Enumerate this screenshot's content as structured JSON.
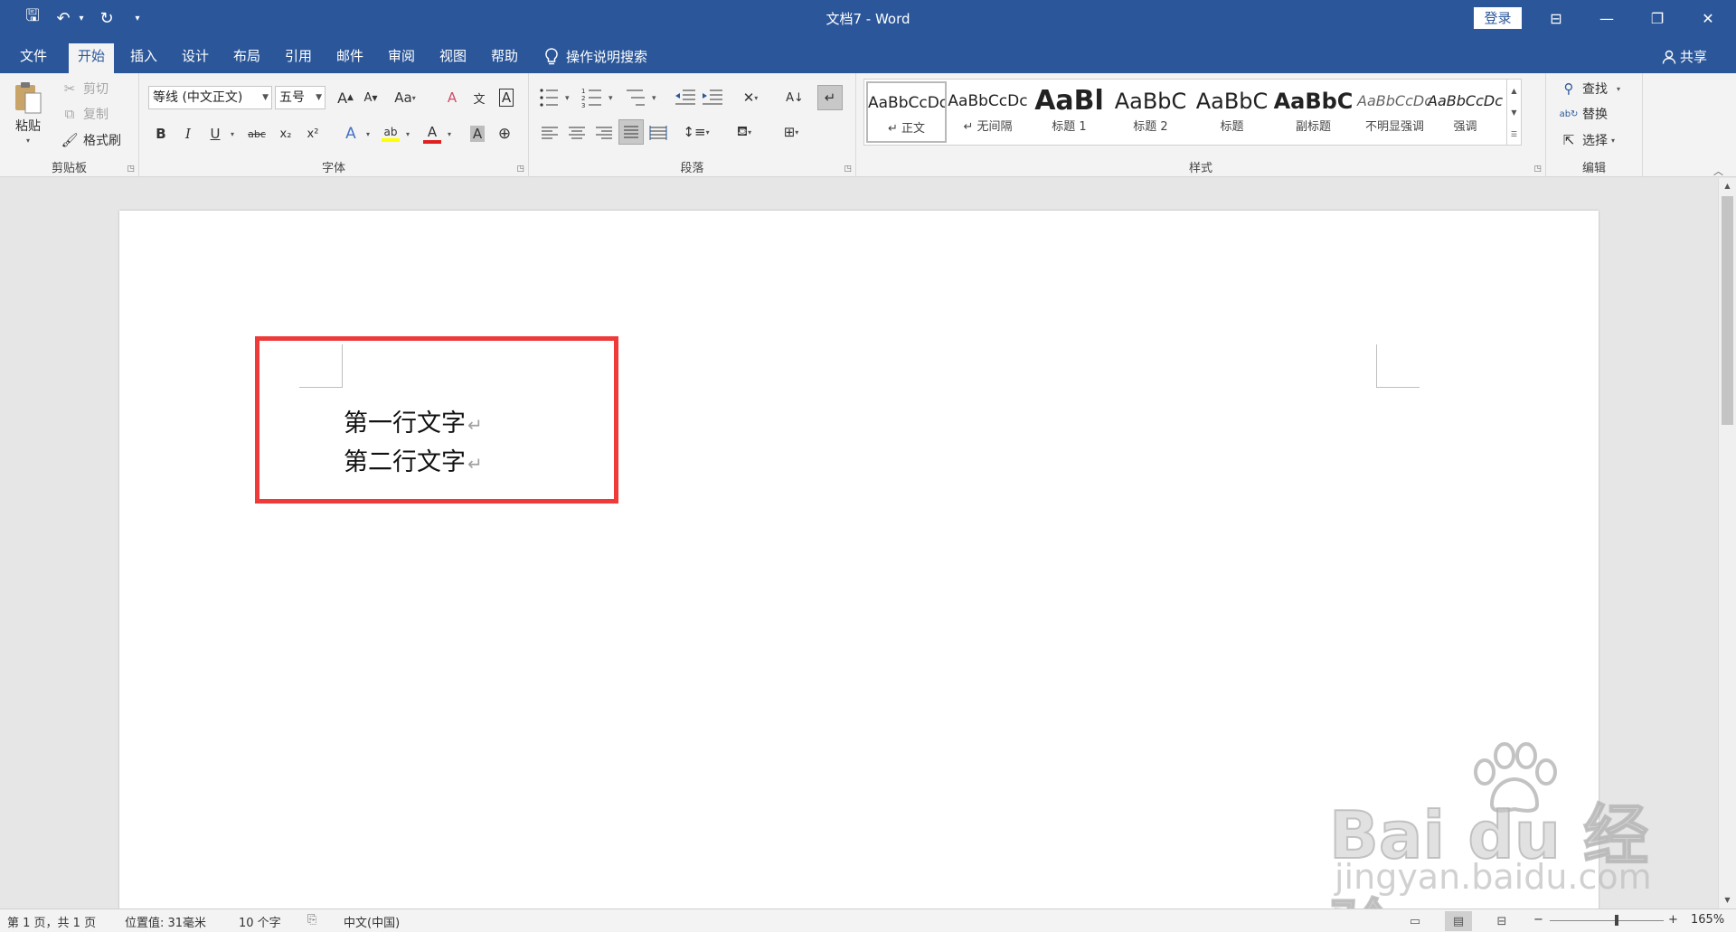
{
  "titlebar": {
    "title": "文档7  -  Word",
    "login_label": "登录",
    "qa_save": "🖫",
    "qa_undo": "↶",
    "qa_undo_caret": "▾",
    "qa_redo": "↻",
    "qa_customize": "▾",
    "win_ribbon_display": "⊟",
    "win_minimize": "—",
    "win_restore": "❐",
    "win_close": "✕"
  },
  "tabs": {
    "items": [
      "文件",
      "开始",
      "插入",
      "设计",
      "布局",
      "引用",
      "邮件",
      "审阅",
      "视图",
      "帮助"
    ],
    "active": "开始",
    "search_label": "操作说明搜索",
    "share_label": "共享"
  },
  "clipboard": {
    "paste": "粘贴",
    "cut": "剪切",
    "copy": "复制",
    "format_painter": "格式刷",
    "label": "剪贴板"
  },
  "font": {
    "font_name": "等线 (中文正文)",
    "font_size": "五号",
    "grow": "A",
    "shrink": "A",
    "change_case": "Aa",
    "clear_format": "A",
    "phonetic": "文",
    "char_border": "A",
    "bold": "B",
    "italic": "I",
    "underline": "U",
    "strike": "abc",
    "subscript": "x₂",
    "superscript": "x²",
    "text_effects": "A",
    "highlight": "ab",
    "font_color": "A",
    "char_shading": "A",
    "enclose": "⊕",
    "label": "字体"
  },
  "paragraph": {
    "label": "段落"
  },
  "styles": {
    "items": [
      {
        "preview": "AaBbCcDc",
        "name": "↵ 正文"
      },
      {
        "preview": "AaBbCcDc",
        "name": "↵ 无间隔"
      },
      {
        "preview": "AaBl",
        "name": "标题 1"
      },
      {
        "preview": "AaBbC",
        "name": "标题 2"
      },
      {
        "preview": "AaBbC",
        "name": "标题"
      },
      {
        "preview": "AaBbC",
        "name": "副标题"
      },
      {
        "preview": "AaBbCcDc",
        "name": "不明显强调"
      },
      {
        "preview": "AaBbCcDc",
        "name": "强调"
      }
    ],
    "label": "样式"
  },
  "editing": {
    "find": "查找",
    "replace": "替换",
    "select": "选择",
    "label": "编辑"
  },
  "document": {
    "lines": [
      "第一行文字",
      "第二行文字"
    ],
    "para_mark": "↵"
  },
  "watermark": {
    "logo": "Bai du 经验",
    "url": "jingyan.baidu.com"
  },
  "statusbar": {
    "page": "第 1 页，共 1 页",
    "position": "位置值: 31毫米",
    "words": "10 个字",
    "language": "中文(中国)",
    "zoom_minus": "−",
    "zoom_plus": "+",
    "zoom_level": "165%"
  },
  "colors": {
    "brand": "#2b579a",
    "highlight_box": "#ef3a3a",
    "font_color_bar": "#e02020",
    "highlight_bar": "#ffff00"
  }
}
